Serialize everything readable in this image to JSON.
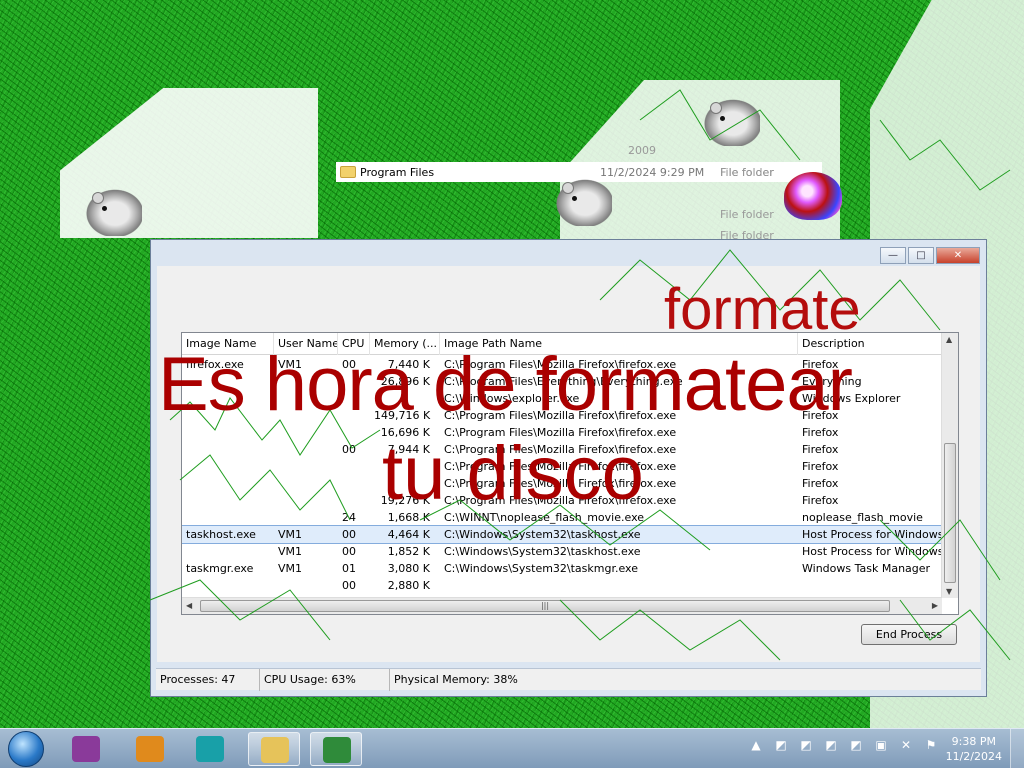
{
  "background_explorer": {
    "rows": [
      {
        "name": "Program Files",
        "date": "11/2/2024 9:29 PM",
        "type": "File folder"
      }
    ],
    "fragments": [
      "2009",
      "File folder",
      "File folder",
      "File folder"
    ]
  },
  "task_manager": {
    "columns": [
      "Image Name",
      "User Name",
      "CPU",
      "Memory (...",
      "Image Path Name",
      "Description"
    ],
    "rows": [
      {
        "name": "firefox.exe",
        "user": "VM1",
        "cpu": "00",
        "mem": "7,440 K",
        "path": "C:\\Program Files\\Mozilla Firefox\\firefox.exe",
        "desc": "Firefox"
      },
      {
        "name": "",
        "user": "",
        "cpu": "",
        "mem": "26,896 K",
        "path": "C:\\Program Files\\Everything\\Everything.exe",
        "desc": "Everything"
      },
      {
        "name": "",
        "user": "",
        "cpu": "",
        "mem": "",
        "path": "C:\\Windows\\explorer.exe",
        "desc": "Windows Explorer"
      },
      {
        "name": "",
        "user": "",
        "cpu": "",
        "mem": "149,716 K",
        "path": "C:\\Program Files\\Mozilla Firefox\\firefox.exe",
        "desc": "Firefox"
      },
      {
        "name": "",
        "user": "",
        "cpu": "",
        "mem": "16,696 K",
        "path": "C:\\Program Files\\Mozilla Firefox\\firefox.exe",
        "desc": "Firefox"
      },
      {
        "name": "",
        "user": "",
        "cpu": "00",
        "mem": "7,944 K",
        "path": "C:\\Program Files\\Mozilla Firefox\\firefox.exe",
        "desc": "Firefox"
      },
      {
        "name": "",
        "user": "",
        "cpu": "",
        "mem": "",
        "path": "C:\\Program Files\\Mozilla Firefox\\firefox.exe",
        "desc": "Firefox"
      },
      {
        "name": "",
        "user": "",
        "cpu": "",
        "mem": "",
        "path": "C:\\Program Files\\Mozilla Firefox\\firefox.exe",
        "desc": "Firefox"
      },
      {
        "name": "",
        "user": "",
        "cpu": "",
        "mem": "19,276 K",
        "path": "C:\\Program Files\\Mozilla Firefox\\firefox.exe",
        "desc": "Firefox"
      },
      {
        "name": "",
        "user": "",
        "cpu": "24",
        "mem": "1,668 K",
        "path": "C:\\WINNT\\noplease_flash_movie.exe",
        "desc": "noplease_flash_movie"
      },
      {
        "name": "taskhost.exe",
        "user": "VM1",
        "cpu": "00",
        "mem": "4,464 K",
        "path": "C:\\Windows\\System32\\taskhost.exe",
        "desc": "Host Process for Windows Tasks",
        "selected": true
      },
      {
        "name": "",
        "user": "VM1",
        "cpu": "00",
        "mem": "1,852 K",
        "path": "C:\\Windows\\System32\\taskhost.exe",
        "desc": "Host Process for Windows Tasks"
      },
      {
        "name": "taskmgr.exe",
        "user": "VM1",
        "cpu": "01",
        "mem": "3,080 K",
        "path": "C:\\Windows\\System32\\taskmgr.exe",
        "desc": "Windows Task Manager"
      },
      {
        "name": "",
        "user": "",
        "cpu": "00",
        "mem": "2,880 K",
        "path": "",
        "desc": ""
      }
    ],
    "end_process_label": "End Process",
    "status": {
      "processes": "Processes: 47",
      "cpu_usage": "CPU Usage: 63%",
      "physical_memory": "Physical Memory: 38%"
    },
    "window_buttons": {
      "minimize": "—",
      "maximize": "□",
      "close": "✕"
    }
  },
  "overlay_message": {
    "line1": "Es hora de formatear",
    "line2": "tu disco",
    "ghost": "formate"
  },
  "taskbar": {
    "pinned": [
      {
        "icon": "winrar-icon",
        "color": "#8a3a9a"
      },
      {
        "icon": "media-icon",
        "color": "#e08a1c"
      },
      {
        "icon": "globe-icon",
        "color": "#18a0a8"
      },
      {
        "icon": "folder-icon",
        "color": "#e6c35a"
      },
      {
        "icon": "task-manager-icon",
        "color": "#2f8b3a"
      }
    ],
    "clock_time": "9:38 PM",
    "clock_date": "11/2/2024"
  },
  "colors": {
    "message_red": "#aa0000",
    "desktop_green": "#22a822"
  }
}
